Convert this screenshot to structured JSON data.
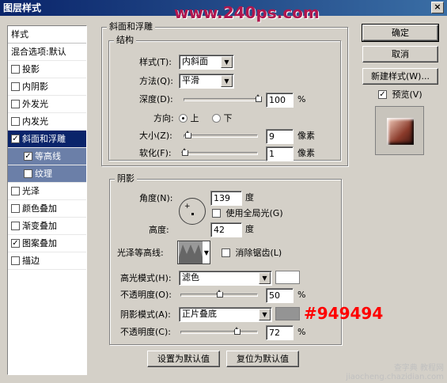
{
  "window": {
    "title": "图层样式",
    "close_glyph": "×",
    "watermark": "www.240ps.com"
  },
  "styles_list": {
    "header": "样式",
    "blend": "混合选项:默认",
    "items": [
      {
        "label": "投影",
        "checked": false
      },
      {
        "label": "内阴影",
        "checked": false
      },
      {
        "label": "外发光",
        "checked": false
      },
      {
        "label": "内发光",
        "checked": false
      },
      {
        "label": "斜面和浮雕",
        "checked": true,
        "selected": true
      },
      {
        "label": "等高线",
        "checked": true,
        "sub": true
      },
      {
        "label": "纹理",
        "checked": false,
        "sub": true
      },
      {
        "label": "光泽",
        "checked": false
      },
      {
        "label": "颜色叠加",
        "checked": false
      },
      {
        "label": "渐变叠加",
        "checked": false
      },
      {
        "label": "图案叠加",
        "checked": true
      },
      {
        "label": "描边",
        "checked": false
      }
    ]
  },
  "bevel": {
    "section_title": "斜面和浮雕",
    "structure_title": "结构",
    "style_label": "样式(T):",
    "style_value": "内斜面",
    "technique_label": "方法(Q):",
    "technique_value": "平滑",
    "depth_label": "深度(D):",
    "depth_value": "100",
    "depth_unit": "%",
    "depth_fraction": 1.0,
    "direction_label": "方向:",
    "direction_up": "上",
    "direction_down": "下",
    "size_label": "大小(Z):",
    "size_value": "9",
    "size_unit": "像素",
    "size_fraction": 0.05,
    "soften_label": "软化(F):",
    "soften_value": "1",
    "soften_unit": "像素",
    "soften_fraction": 0.01
  },
  "shading": {
    "title": "阴影",
    "angle_label": "角度(N):",
    "angle_value": "139",
    "angle_unit": "度",
    "global_light_label": "使用全局光(G)",
    "altitude_label": "高度:",
    "altitude_value": "42",
    "altitude_unit": "度",
    "gloss_label": "光泽等高线:",
    "antialias_label": "消除锯齿(L)",
    "highlight_mode_label": "高光模式(H):",
    "highlight_mode_value": "滤色",
    "highlight_color": "#ffffff",
    "highlight_opacity_label": "不透明度(O):",
    "highlight_opacity_value": "50",
    "highlight_opacity_fraction": 0.5,
    "shadow_mode_label": "阴影模式(A):",
    "shadow_mode_value": "正片叠底",
    "shadow_color": "#949494",
    "shadow_opacity_label": "不透明度(C):",
    "shadow_opacity_value": "72",
    "shadow_opacity_fraction": 0.72,
    "opacity_unit": "%",
    "hex_annotation": "#949494"
  },
  "buttons": {
    "make_default": "设置为默认值",
    "reset_default": "复位为默认值",
    "ok": "确定",
    "cancel": "取消",
    "new_style": "新建样式(W)...",
    "preview": "预览(V)"
  },
  "footer": {
    "line1": "查字典 教程网",
    "line2": "jiaocheng.chazidian.com"
  }
}
